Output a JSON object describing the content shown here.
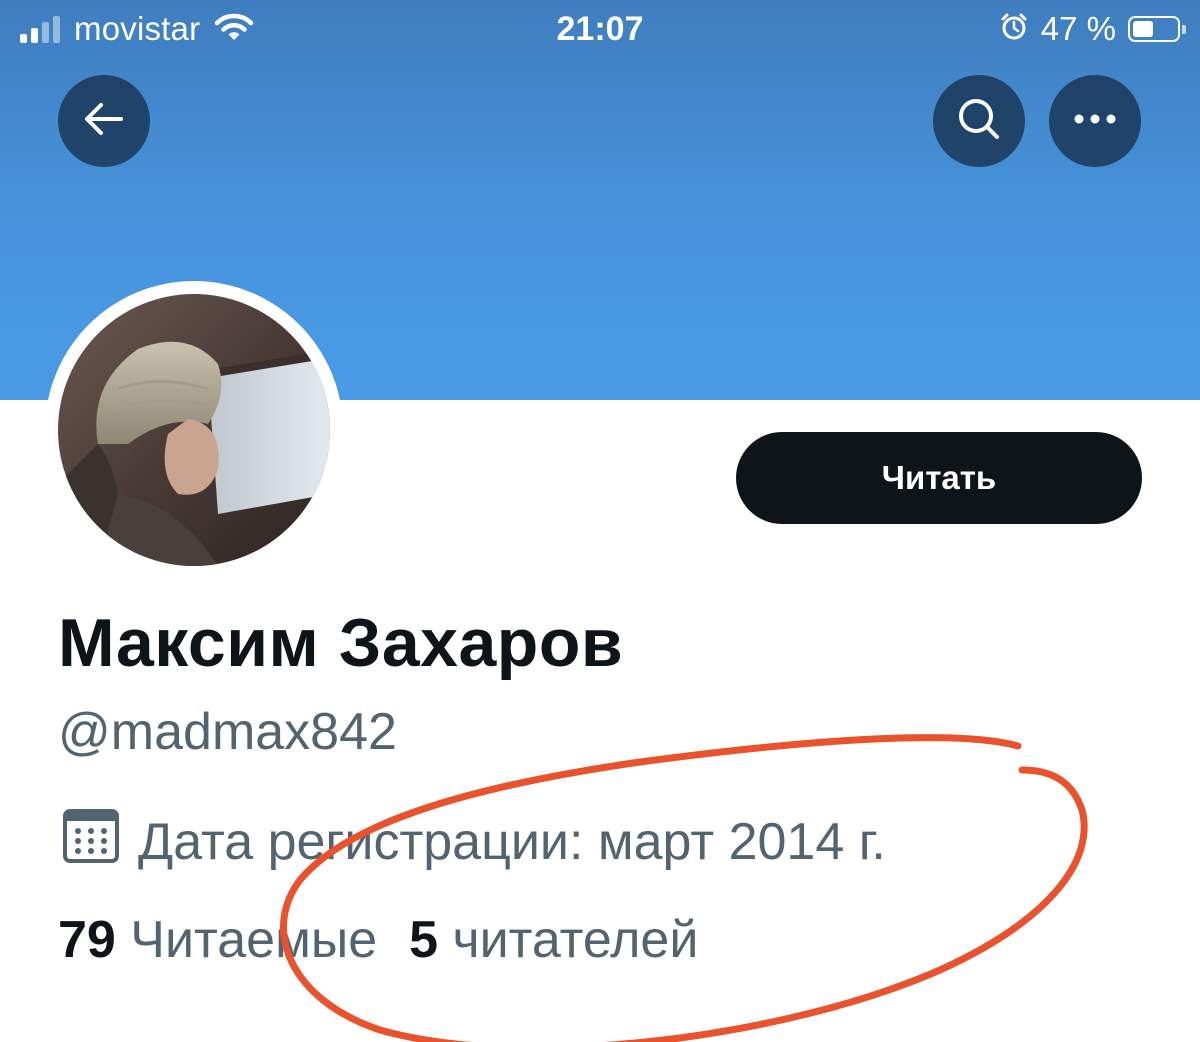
{
  "status_bar": {
    "carrier": "movistar",
    "time": "21:07",
    "battery_percent": "47 %",
    "battery_level": 0.47
  },
  "profile": {
    "name": "Максим Захаров",
    "handle": "@madmax842",
    "joined": "Дата регистрации: март 2014 г.",
    "following_count": "79",
    "following_label": "Читаемые",
    "followers_count": "5",
    "followers_label": "читателей"
  },
  "actions": {
    "follow_label": "Читать"
  },
  "colors": {
    "banner": "#4794dc",
    "text_primary": "#0f1419",
    "text_secondary": "#536471",
    "annotation": "#e8532e",
    "button_bg": "#0f1419"
  },
  "icons": [
    "back-arrow-icon",
    "search-icon",
    "more-icon",
    "calendar-icon",
    "wifi-icon",
    "alarm-icon",
    "battery-icon",
    "signal-icon"
  ]
}
